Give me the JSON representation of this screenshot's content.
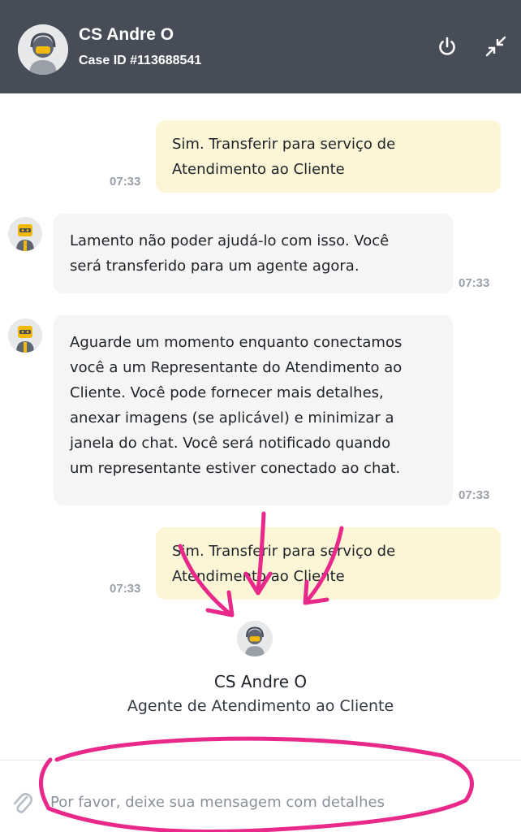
{
  "header": {
    "agent_name": "CS Andre O",
    "case_id": "Case ID #113688541",
    "icons": {
      "power": "power-icon",
      "minimize": "minimize-arrows-icon"
    },
    "background_color": "#474d57"
  },
  "messages": [
    {
      "from": "user",
      "text_lines": [
        "Sim. Transferir para serviço de",
        "Atendimento ao Cliente"
      ],
      "time": "07:33"
    },
    {
      "from": "bot",
      "text_lines": [
        "Lamento não poder ajudá-lo com isso. Você",
        "será transferido para um agente agora."
      ],
      "time": "07:33"
    },
    {
      "from": "bot",
      "text_lines": [
        "Aguarde um momento enquanto conectamos",
        "você a um Representante do Atendimento ao",
        "Cliente. Você pode fornecer mais detalhes,",
        "anexar imagens (se aplicável) e minimizar a",
        "janela do chat. Você será notificado quando",
        "um representante estiver conectado ao chat."
      ],
      "time": "07:33"
    },
    {
      "from": "user",
      "text_lines": [
        "Sim. Transferir para serviço de",
        "Atendimento ao Cliente"
      ],
      "time": "07:33"
    }
  ],
  "agent_card": {
    "name": "CS Andre O",
    "role": "Agente de Atendimento ao Cliente"
  },
  "composer": {
    "placeholder": "Por favor, deixe sua mensagem com detalhes",
    "value": "",
    "attach_icon": "paperclip-icon"
  },
  "colors": {
    "user_bubble": "#fdf6d6",
    "bot_bubble": "#f5f5f5",
    "annotation": "#e8298a",
    "avatar_yellow": "#f0b90b"
  }
}
